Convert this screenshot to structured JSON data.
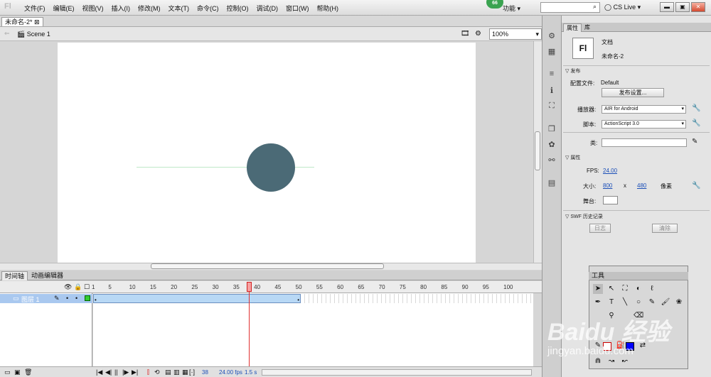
{
  "menubar": {
    "logo": "Fl",
    "items": [
      "文件(F)",
      "编辑(E)",
      "视图(V)",
      "插入(I)",
      "修改(M)",
      "文本(T)",
      "命令(C)",
      "控制(O)",
      "调试(D)",
      "窗口(W)",
      "帮助(H)"
    ],
    "badge": "66",
    "workspace": "功能 ▾",
    "cslive": "CS Live"
  },
  "doc": {
    "tab": "未命名-2*",
    "scene": "Scene 1",
    "zoom": "100%"
  },
  "timeline": {
    "tabs": [
      "时间轴",
      "动画编辑器"
    ],
    "layer": "图层 1",
    "frame_numbers": [
      "1",
      "5",
      "10",
      "15",
      "20",
      "25",
      "30",
      "35",
      "40",
      "45",
      "50",
      "55",
      "60",
      "65",
      "70",
      "75",
      "80",
      "85",
      "90",
      "95",
      "100"
    ],
    "current_frame": "38",
    "fps": "24.00 fps",
    "time": "1.5 s"
  },
  "props": {
    "tabs": [
      "属性",
      "库"
    ],
    "doc_label": "文档",
    "doc_name": "未命名-2",
    "publish_section": "发布",
    "profile_label": "配置文件:",
    "profile_value": "Default",
    "publish_settings": "发布设置...",
    "player_label": "播放器:",
    "player_value": "AIR for Android",
    "script_label": "脚本:",
    "script_value": "ActionScript 3.0",
    "class_label": "类:",
    "properties_section": "属性",
    "fps_label": "FPS:",
    "fps_value": "24.00",
    "size_label": "大小:",
    "width": "800",
    "x": "x",
    "height": "480",
    "unit": "像素",
    "stage_label": "舞台:",
    "swf_section": "SWF 历史记录",
    "log_btn": "日志",
    "clear_btn": "清除"
  },
  "tools": {
    "title": "工具"
  },
  "watermark": {
    "main": "Baidu 经验",
    "url": "jingyan.baidu.com"
  }
}
